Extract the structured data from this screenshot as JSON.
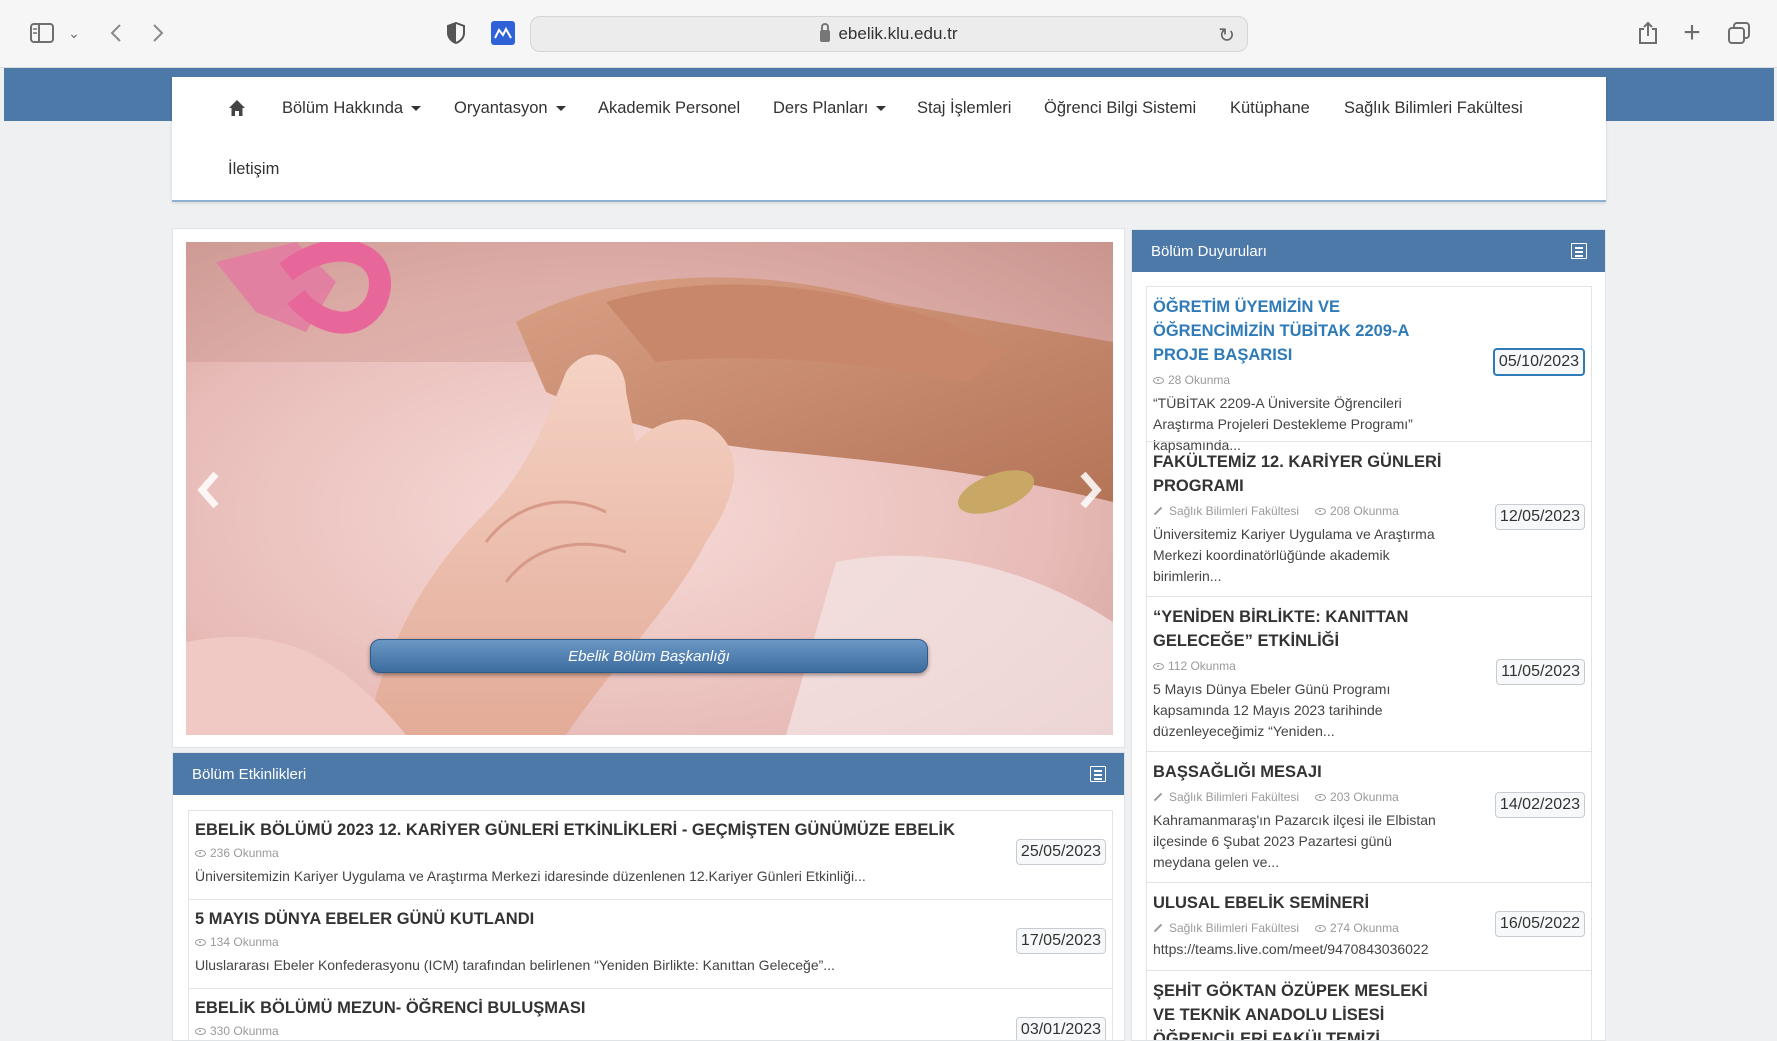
{
  "browser": {
    "url": "ebelik.klu.edu.tr"
  },
  "nav": {
    "items": [
      {
        "label": "Bölüm Hakkında",
        "dropdown": true
      },
      {
        "label": "Oryantasyon",
        "dropdown": true
      },
      {
        "label": "Akademik Personel",
        "dropdown": false
      },
      {
        "label": "Ders Planları",
        "dropdown": true
      },
      {
        "label": "Staj İşlemleri",
        "dropdown": false
      },
      {
        "label": "Öğrenci Bilgi Sistemi",
        "dropdown": false
      },
      {
        "label": "Kütüphane",
        "dropdown": false
      },
      {
        "label": "Sağlık Bilimleri Fakültesi",
        "dropdown": false
      },
      {
        "label": "İletişim",
        "dropdown": false
      }
    ]
  },
  "slider": {
    "caption": "Ebelik Bölüm Başkanlığı"
  },
  "events": {
    "title": "Bölüm Etkinlikleri",
    "items": [
      {
        "title": "EBELİK BÖLÜMÜ 2023 12. KARİYER GÜNLERİ ETKİNLİKLERİ - GEÇMİŞTEN GÜNÜMÜZE EBELİK",
        "views": "236 Okunma",
        "text": "Üniversitemizin Kariyer Uygulama ve Araştırma Merkezi idaresinde düzenlenen 12.Kariyer Günleri Etkinliği...",
        "date": "25/05/2023"
      },
      {
        "title": "5 MAYIS DÜNYA EBELER GÜNÜ KUTLANDI",
        "views": "134 Okunma",
        "text": "Uluslararası Ebeler Konfederasyonu (ICM) tarafından belirlenen “Yeniden Birlikte: Kanıttan Geleceğe”...",
        "date": "17/05/2023"
      },
      {
        "title": "EBELİK BÖLÜMÜ MEZUN- ÖĞRENCİ BULUŞMASI",
        "views": "330 Okunma",
        "text": "",
        "date": "03/01/2023"
      }
    ]
  },
  "announcements": {
    "title": "Bölüm Duyuruları",
    "items": [
      {
        "title": "ÖĞRETİM ÜYEMİZİN VE ÖĞRENCİMİZİN TÜBİTAK 2209-A PROJE BAŞARISI",
        "source": "",
        "views": "28 Okunma",
        "text": "“TÜBİTAK 2209-A Üniversite Öğrencileri Araştırma Projeleri Destekleme Programı” kapsamında...",
        "date": "05/10/2023"
      },
      {
        "title": "FAKÜLTEMİZ 12. KARİYER GÜNLERİ PROGRAMI",
        "source": "Sağlık Bilimleri Fakültesi",
        "views": "208 Okunma",
        "text": "Üniversitemiz Kariyer Uygulama ve Araştırma Merkezi koordinatörlüğünde akademik birimlerin...",
        "date": "12/05/2023"
      },
      {
        "title": "“YENİDEN BİRLİKTE: KANITTAN GELECEĞE” ETKİNLİĞİ",
        "source": "",
        "views": "112 Okunma",
        "text": "5 Mayıs Dünya Ebeler Günü Programı kapsamında 12 Mayıs 2023 tarihinde düzenleyeceğimiz “Yeniden...",
        "date": "11/05/2023"
      },
      {
        "title": "BAŞSAĞLIĞI MESAJI",
        "source": "Sağlık Bilimleri Fakültesi",
        "views": "203 Okunma",
        "text": "Kahramanmaraş'ın Pazarcık ilçesi ile Elbistan ilçesinde 6 Şubat 2023 Pazartesi günü meydana gelen ve...",
        "date": "14/02/2023"
      },
      {
        "title": "ULUSAL EBELİK SEMİNERİ",
        "source": "Sağlık Bilimleri Fakültesi",
        "views": "274 Okunma",
        "text": "https://teams.live.com/meet/9470843036022",
        "date": "16/05/2022"
      },
      {
        "title": "ŞEHİT GÖKTAN ÖZÜPEK MESLEKİ VE TEKNİK ANADOLU LİSESİ ÖĞRENCİLERİ FAKÜLTEMİZİ ZİYARET ETTİ",
        "source": "",
        "views": "",
        "text": "",
        "date": ""
      }
    ]
  }
}
